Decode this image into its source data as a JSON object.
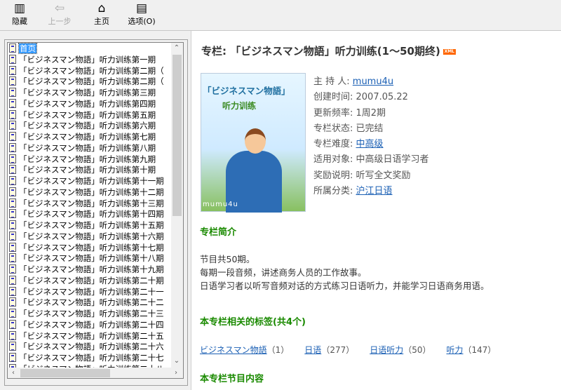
{
  "toolbar": {
    "hide": "隐藏",
    "back": "上一步",
    "home": "主页",
    "options": "选项(O)"
  },
  "tree": {
    "home": "首页",
    "items": [
      "「ビジネスマン物語」听力训练第一期",
      "「ビジネスマン物語」听力训练第二期（",
      "「ビジネスマン物語」听力训练第二期（",
      "「ビジネスマン物語」听力训练第三期",
      "「ビジネスマン物語」听力训练第四期",
      "「ビジネスマン物語」听力训练第五期",
      "「ビジネスマン物語」听力训练第六期",
      "「ビジネスマン物語」听力训练第七期",
      "「ビジネスマン物語」听力训练第八期",
      "「ビジネスマン物語」听力训练第九期",
      "「ビジネスマン物語」听力训练第十期",
      "「ビジネスマン物語」听力训练第十一期",
      "「ビジネスマン物語」听力训练第十二期",
      "「ビジネスマン物語」听力训练第十三期",
      "「ビジネスマン物語」听力训练第十四期",
      "「ビジネスマン物語」听力训练第十五期",
      "「ビジネスマン物語」听力训练第十六期",
      "「ビジネスマン物語」听力训练第十七期",
      "「ビジネスマン物語」听力训练第十八期",
      "「ビジネスマン物語」听力训练第十九期",
      "「ビジネスマン物語」听力训练第二十期",
      "「ビジネスマン物語」听力训练第二十一",
      "「ビジネスマン物語」听力训练第二十二",
      "「ビジネスマン物語」听力训练第二十三",
      "「ビジネスマン物語」听力训练第二十四",
      "「ビジネスマン物語」听力训练第二十五",
      "「ビジネスマン物語」听力训练第二十六",
      "「ビジネスマン物語」听力训练第二十七",
      "「ビジネスマン物語」听力训练第二十八"
    ]
  },
  "main": {
    "title": "专栏: 「ビジネスマン物語」听力训练(1～50期终)",
    "xml_badge": "XML",
    "cover": {
      "line1": "「ビジネスマン物語」",
      "line2": "听力训练",
      "watermark": "mumu4u"
    },
    "info": [
      {
        "label": "主 持 人: ",
        "value": "mumu4u",
        "link": true
      },
      {
        "label": "创建时间: ",
        "value": "2007.05.22",
        "link": false
      },
      {
        "label": "更新频率: ",
        "value": "1周2期",
        "link": false
      },
      {
        "label": "专栏状态: ",
        "value": "已完结",
        "link": false
      },
      {
        "label": "专栏难度: ",
        "value": "中高级",
        "link": true
      },
      {
        "label": "适用对象: ",
        "value": "中高级日语学习者",
        "link": false
      },
      {
        "label": "奖励说明: ",
        "value": "听写全文奖励",
        "link": false
      },
      {
        "label": "所属分类: ",
        "value": "沪江日语",
        "link": true
      }
    ],
    "intro_heading": "专栏简介",
    "intro": [
      "节目共50期。",
      "每期一段音频，讲述商务人员的工作故事。",
      "日语学习者以听写音频对话的方式练习日语听力，并能学习日语商务用语。"
    ],
    "tags_heading": "本专栏相关的标签(共4个)",
    "tags": [
      {
        "name": "ビジネスマン物語",
        "count": "（1）"
      },
      {
        "name": "日语",
        "count": "（277）"
      },
      {
        "name": "日语听力",
        "count": "（50）"
      },
      {
        "name": "听力",
        "count": "（147）"
      }
    ],
    "content_heading": "本专栏节目内容"
  },
  "colors": {
    "heading_green": "#1a8a00",
    "link_blue": "#1a5fb4",
    "selection": "#3399ff"
  }
}
